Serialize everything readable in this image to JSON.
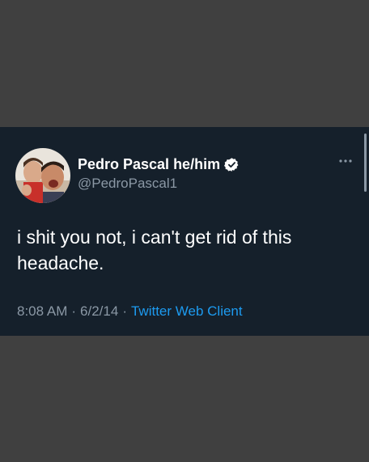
{
  "tweet": {
    "display_name": "Pedro Pascal he/him",
    "handle": "@PedroPascal1",
    "text": "i shit you not, i can't get rid of this headache.",
    "time": "8:08 AM",
    "date": "6/2/14",
    "separator": "·",
    "source": "Twitter Web Client"
  },
  "icons": {
    "verified": "verified-badge-icon",
    "more": "more-options-icon",
    "avatar": "profile-avatar"
  },
  "colors": {
    "background": "#404040",
    "card": "#15202b",
    "name": "#ffffff",
    "muted": "#8b98a5",
    "link": "#1d9bf0"
  }
}
